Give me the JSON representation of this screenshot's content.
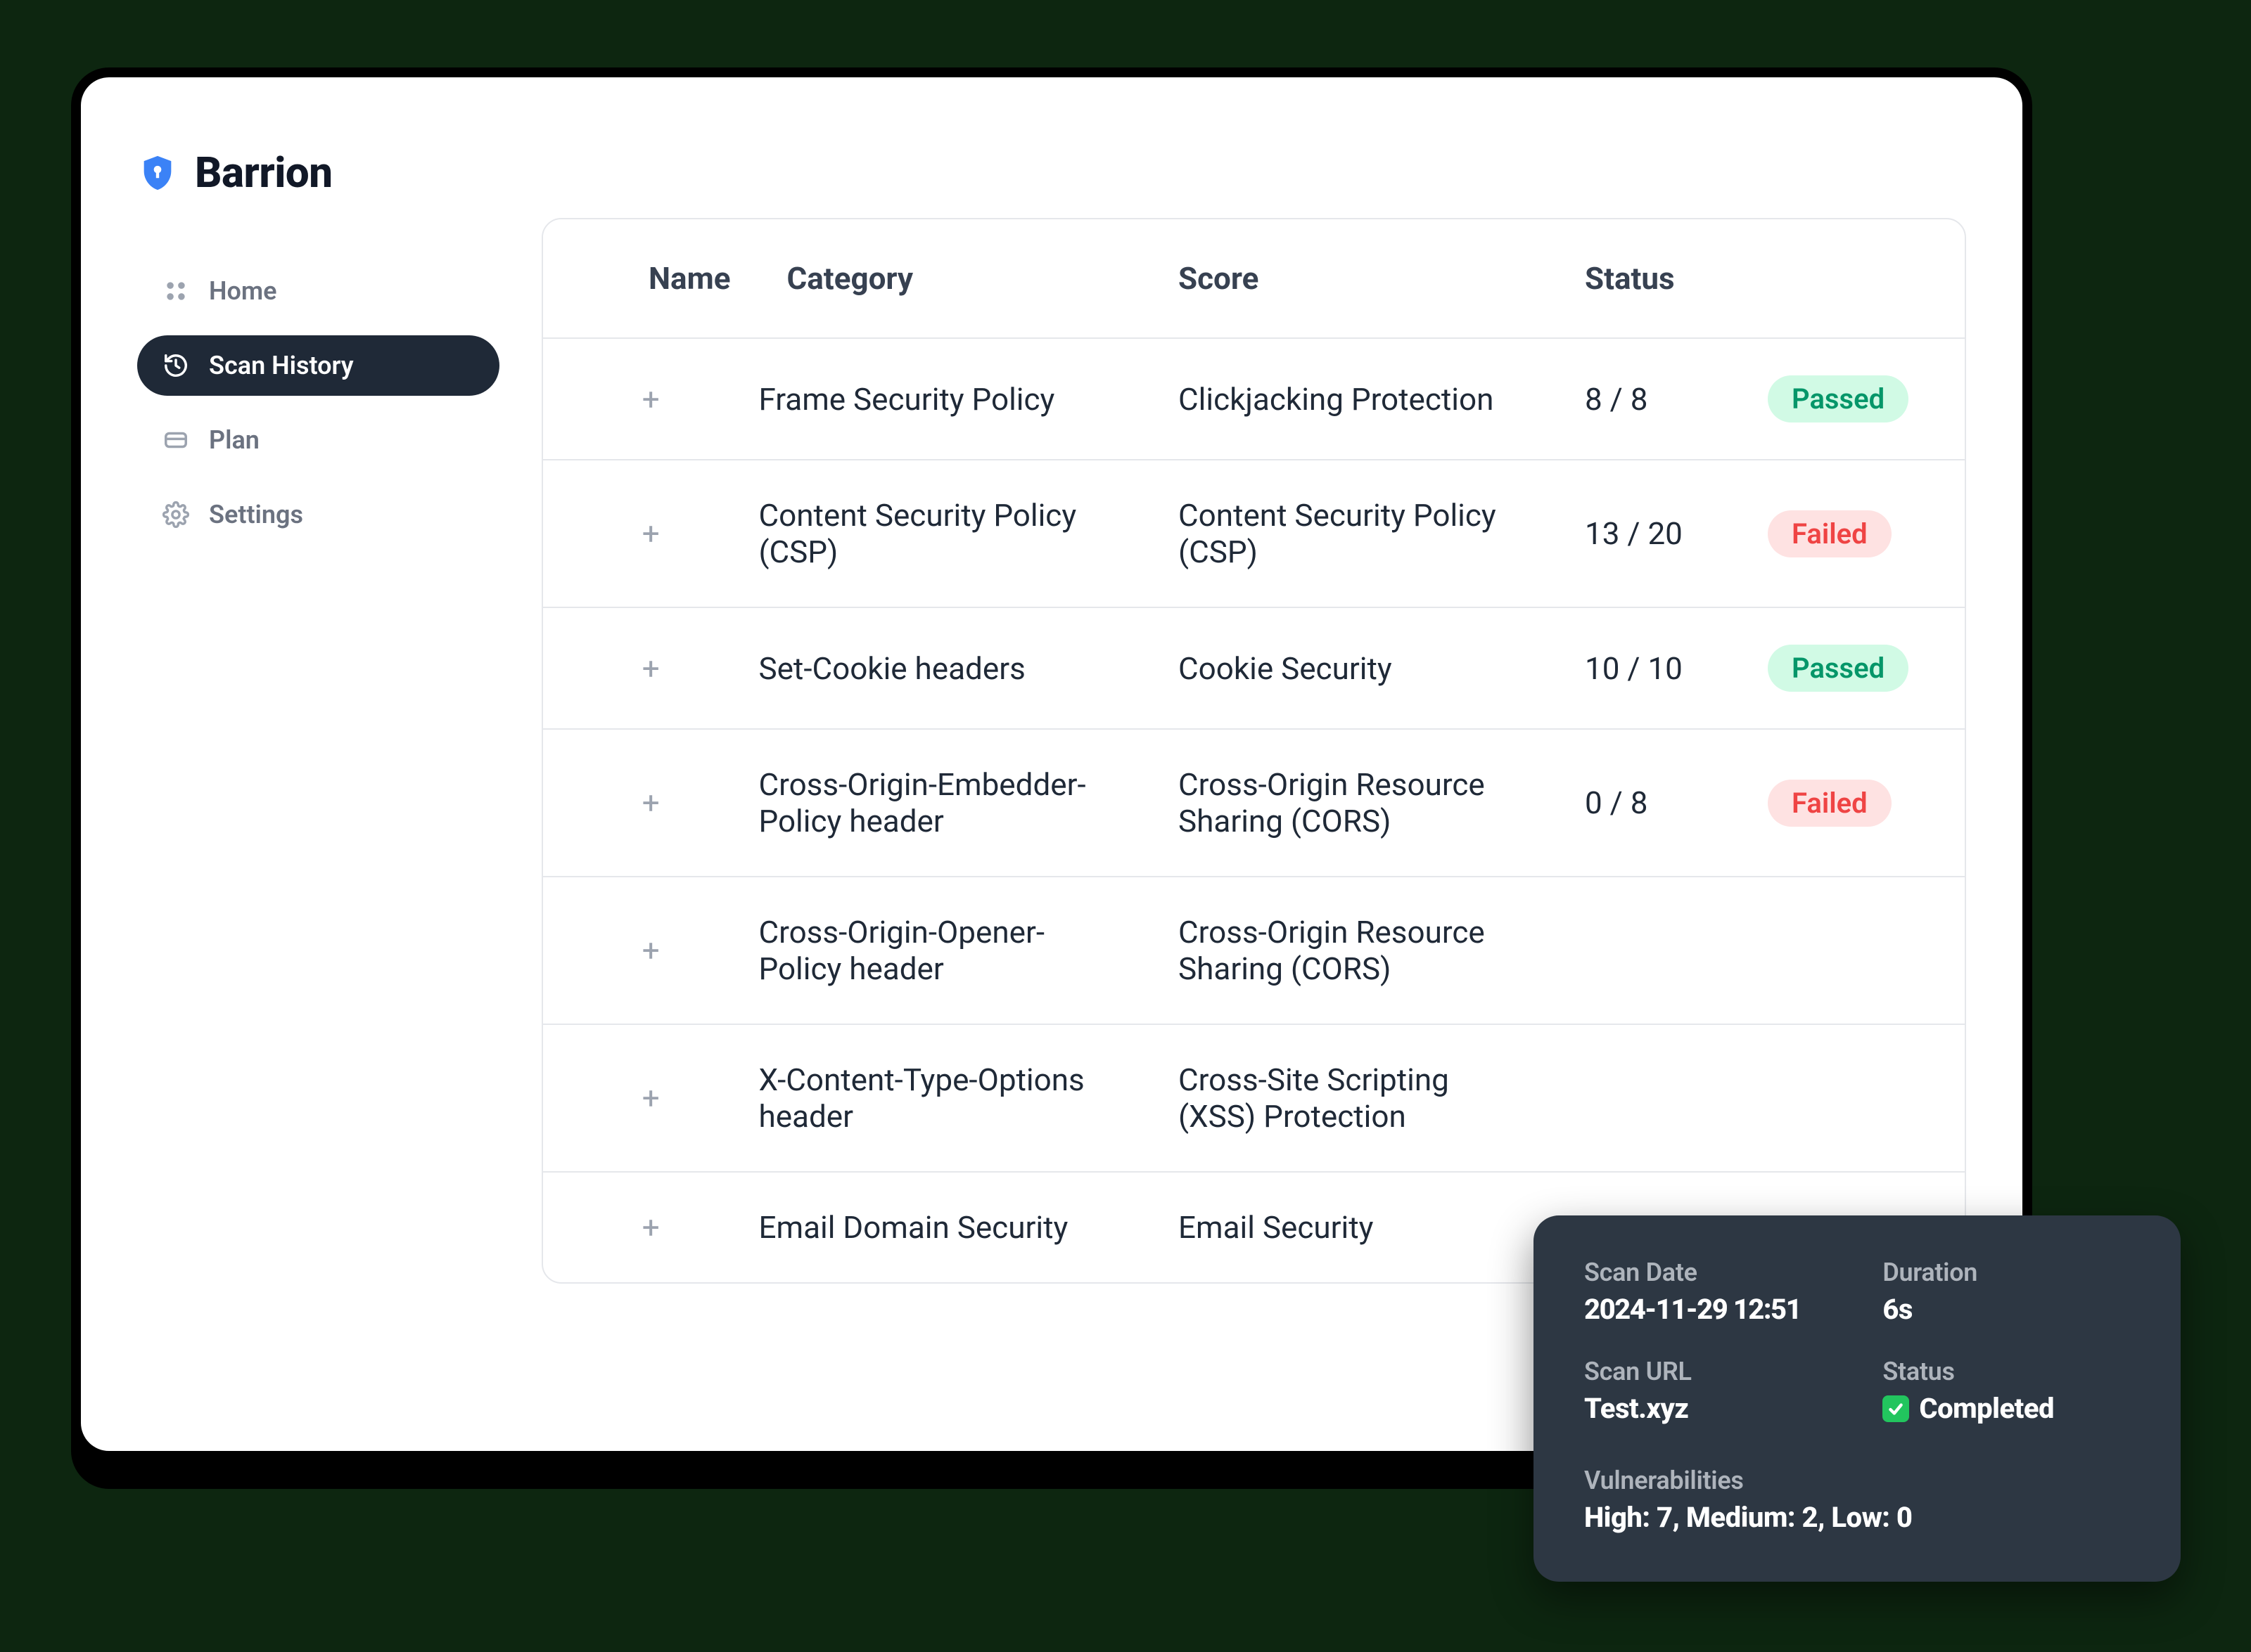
{
  "brand": {
    "name": "Barrion"
  },
  "sidebar": {
    "items": [
      {
        "label": "Home"
      },
      {
        "label": "Scan History"
      },
      {
        "label": "Plan"
      },
      {
        "label": "Settings"
      }
    ]
  },
  "table": {
    "headers": {
      "name": "Name",
      "category": "Category",
      "score": "Score",
      "status": "Status"
    },
    "rows": [
      {
        "name": "Frame Security Policy",
        "category": "Clickjacking Protection",
        "score": "8 / 8",
        "status": "Passed",
        "status_type": "passed"
      },
      {
        "name": "Content Security Policy (CSP)",
        "category": "Content Security Policy (CSP)",
        "score": "13 / 20",
        "status": "Failed",
        "status_type": "failed"
      },
      {
        "name": "Set-Cookie headers",
        "category": "Cookie Security",
        "score": "10 / 10",
        "status": "Passed",
        "status_type": "passed"
      },
      {
        "name": "Cross-Origin-Embedder-Policy header",
        "category": "Cross-Origin Resource Sharing (CORS)",
        "score": "0 / 8",
        "status": "Failed",
        "status_type": "failed"
      },
      {
        "name": "Cross-Origin-Opener-Policy header",
        "category": "Cross-Origin Resource Sharing (CORS)",
        "score": "",
        "status": "",
        "status_type": "failed"
      },
      {
        "name": "X-Content-Type-Options header",
        "category": "Cross-Site Scripting (XSS) Protection",
        "score": "",
        "status": "",
        "status_type": ""
      },
      {
        "name": "Email Domain Security",
        "category": "Email Security",
        "score": "",
        "status": "",
        "status_type": ""
      }
    ]
  },
  "summary": {
    "scan_date_label": "Scan Date",
    "scan_date_value": "2024-11-29 12:51",
    "duration_label": "Duration",
    "duration_value": "6s",
    "scan_url_label": "Scan URL",
    "scan_url_value": "Test.xyz",
    "status_label": "Status",
    "status_value": "Completed",
    "vuln_label": "Vulnerabilities",
    "vuln_value": "High: 7, Medium: 2, Low: 0"
  }
}
